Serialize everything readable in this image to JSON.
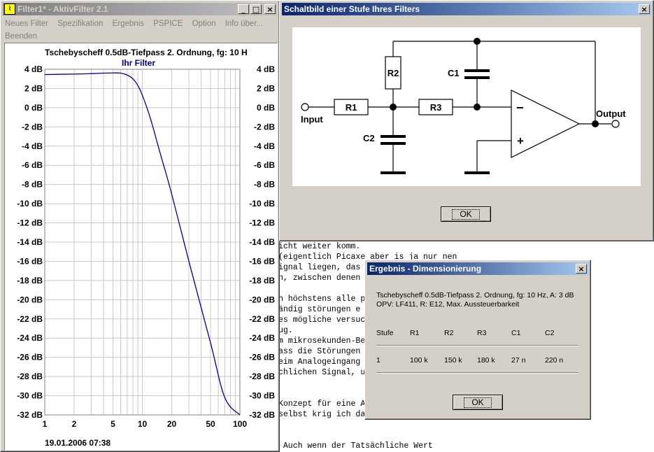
{
  "main_window": {
    "title": "Filter1* - AktivFilter 2.1",
    "menu": [
      "Neues Filter",
      "Spezifikation",
      "Ergebnis",
      "PSPICE",
      "Option",
      "Info über...",
      "Beenden"
    ]
  },
  "chart_title": "Tschebyscheff 0.5dB-Tiefpass 2. Ordnung, fg: 10 H",
  "chart_legend": "Ihr Filter",
  "chart_timestamp": "19.01.2006 07:38",
  "chart_data": {
    "type": "line",
    "title": "Tschebyscheff 0.5dB-Tiefpass 2. Ordnung, fg: 10 H",
    "xscale": "log",
    "xlim": [
      1,
      100
    ],
    "ylim": [
      -32,
      4
    ],
    "xticks": [
      "1",
      "2",
      "5",
      "10",
      "20",
      "50",
      "100"
    ],
    "xtick_values": [
      1,
      2,
      5,
      10,
      20,
      50,
      100
    ],
    "yticks": [
      "4 dB",
      "2 dB",
      "0 dB",
      "-2 dB",
      "-4 dB",
      "-6 dB",
      "-8 dB",
      "-10 dB",
      "-12 dB",
      "-14 dB",
      "-16 dB",
      "-18 dB",
      "-20 dB",
      "-22 dB",
      "-24 dB",
      "-26 dB",
      "-28 dB",
      "-30 dB",
      "-32 dB"
    ],
    "ytick_values": [
      4,
      2,
      0,
      -2,
      -4,
      -6,
      -8,
      -10,
      -12,
      -14,
      -16,
      -18,
      -20,
      -22,
      -24,
      -26,
      -28,
      -30,
      -32
    ],
    "grid": true,
    "series": [
      {
        "name": "Ihr Filter",
        "color": "#00008b",
        "x": [
          1,
          2,
          3,
          4,
          5,
          6,
          7,
          8,
          9,
          10,
          12,
          15,
          20,
          30,
          50,
          70,
          100
        ],
        "y": [
          3.45,
          3.5,
          3.55,
          3.6,
          3.62,
          3.6,
          3.4,
          3.0,
          2.3,
          1.3,
          -1.0,
          -4.5,
          -9.0,
          -16.0,
          -24.5,
          -30.2,
          -32.0
        ]
      }
    ]
  },
  "editor_lines": [
    "icht weiter komm.",
    "(eigentlich Picaxe aber is ja nur nen",
    "ignal liegen, das",
    "n, zwischen denen",
    "",
    "h höchstens alle p",
    "ändig störungen e",
    "es mögliche versuc",
    "ug.",
    "m mikrosekunden-Be",
    "ass die Störungen",
    "eim Analogeingang",
    "chlichen Signal, u",
    "",
    "",
    "Konzept für eine A",
    "selbst krig ich da",
    "",
    "",
    " Auch wenn der Tatsächliche Wert"
  ],
  "schematic_window": {
    "title": "Schaltbild einer Stufe Ihres Filters",
    "ok_label": "OK",
    "labels": {
      "r1": "R1",
      "r2": "R2",
      "r3": "R3",
      "c1": "C1",
      "c2": "C2",
      "input": "Input",
      "output": "Output",
      "minus": "−",
      "plus": "+"
    }
  },
  "result_dialog": {
    "title": "Ergebnis - Dimensionierung",
    "line1": "Tschebyscheff 0.5dB-Tiefpass 2. Ordnung, fg: 10 Hz, A: 3 dB",
    "line2": "OPV: LF411, R: E12, Max. Aussteuerbarkeit",
    "headers": [
      "Stufe",
      "R1",
      "R2",
      "R3",
      "C1",
      "C2"
    ],
    "row": [
      "1",
      "100 k",
      "150 k",
      "180 k",
      "27 n",
      "220 n"
    ],
    "ok_label": "OK"
  },
  "colors": {
    "title_active": "#0a246a",
    "curve": "#00008b",
    "grid": "#c0c0c0"
  }
}
